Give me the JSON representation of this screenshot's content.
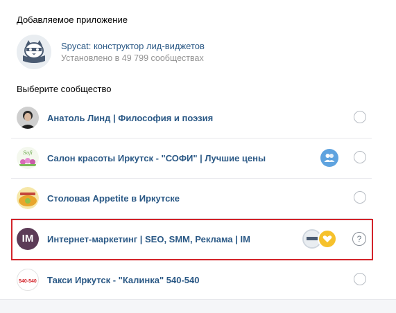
{
  "added_section": {
    "title": "Добавляемое приложение",
    "app": {
      "name": "Spycat: конструктор лид-виджетов",
      "installs": "Установлено в 49 799 сообществах",
      "icon": "cat-mascot-icon"
    }
  },
  "choose_section": {
    "title": "Выберите сообщество",
    "communities": [
      {
        "name": "Анатоль Линд | Философия и поэзия",
        "avatar": "portrait-avatar",
        "control": "radio"
      },
      {
        "name": "Салон красоты Иркутск - \"СОФИ\" | Лучшие цены",
        "avatar": "flowers-avatar",
        "badge": "group-users-icon",
        "control": "radio"
      },
      {
        "name": "Столовая Appetite в Иркутске",
        "avatar": "appetite-logo-avatar",
        "control": "radio"
      },
      {
        "name": "Интернет-маркетинг | SEO, SMM, Реклама | IM",
        "avatar": "im-logo-avatar",
        "avatar_text": "IM",
        "badges": [
          "app-installed-icon",
          "heart-badge-icon"
        ],
        "control": "help",
        "help_symbol": "?",
        "selected": true
      },
      {
        "name": "Такси Иркутск - \"Калинка\" 540-540",
        "avatar": "taxi-logo-avatar",
        "avatar_text": "540-540",
        "control": "radio"
      }
    ]
  },
  "colors": {
    "link": "#2a5885",
    "muted": "#939393",
    "highlight": "#d3232a",
    "badge_blue": "#5fa3df",
    "badge_gold": "#f6c12c"
  }
}
